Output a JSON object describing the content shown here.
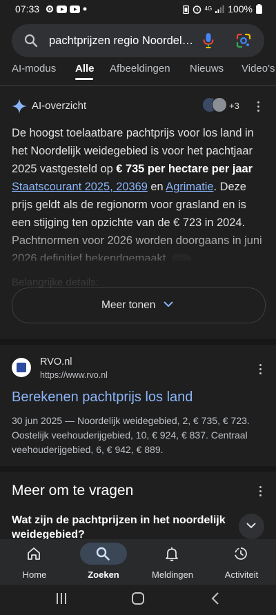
{
  "status": {
    "time": "07:33",
    "battery": "100%",
    "network": "4G"
  },
  "search": {
    "query": "pachtprijzen regio Noordelijk weidegebied",
    "icons": [
      "search-icon",
      "mic-icon",
      "google-lens-icon"
    ]
  },
  "tabs": [
    "AI-modus",
    "Alle",
    "Afbeeldingen",
    "Nieuws",
    "Video's"
  ],
  "active_tab": "Alle",
  "ai_overview": {
    "title": "AI-overzicht",
    "source_count": "+3",
    "text": {
      "p1": "De hoogst toelaatbare pachtprijs voor los land in het Noordelijk weidegebied is voor het pachtjaar 2025 vastgesteld op ",
      "bold": "€ 735 per hectare per jaar",
      "link1": "Staatscourant 2025, 20369",
      "p2": " en ",
      "link2": "Agrimatie",
      "p3": ". Deze prijs geldt als de regionorm voor grasland en is een stijging ten opzichte van de € 723 in 2024. Pachtnormen voor 2026 worden doorgaans in juni 2026 definitief bekendgemaakt."
    },
    "faded_heading": "Belangrijke details:",
    "more_button": "Meer tonen"
  },
  "result": {
    "site_name": "RVO.nl",
    "url": "https://www.rvo.nl",
    "title": "Berekenen pachtprijs los land",
    "snippet": "30 jun 2025 — Noordelijk weidegebied, 2, € 735, € 723. Oostelijk veehouderijgebied, 10, € 924, € 837. Centraal veehouderijgebied, 6, € 942, € 889."
  },
  "people_also_ask": {
    "title": "Meer om te vragen",
    "question": "Wat zijn de pachtprijzen in het noordelijk weidegebied?"
  },
  "bottom_nav": [
    {
      "label": "Home",
      "icon": "home-icon"
    },
    {
      "label": "Zoeken",
      "icon": "search-icon"
    },
    {
      "label": "Meldingen",
      "icon": "bell-icon"
    },
    {
      "label": "Activiteit",
      "icon": "activity-icon"
    }
  ],
  "bottom_nav_active": "Zoeken",
  "colors": {
    "background": "#1f1f1f",
    "link": "#8ab4f8",
    "searchbar": "#303134"
  }
}
